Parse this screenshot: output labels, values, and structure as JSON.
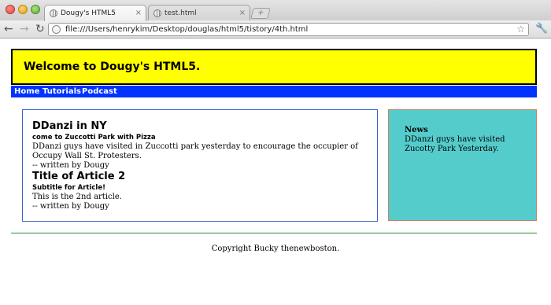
{
  "browser": {
    "tabs": [
      {
        "title": "Dougy's HTML5",
        "active": true
      },
      {
        "title": "test.html",
        "active": false
      }
    ],
    "close_glyph": "×",
    "new_tab_glyph": "+",
    "url": "file:///Users/henrykim/Desktop/douglas/html5/tistory/4th.html",
    "icons": {
      "back": "back-arrow-icon",
      "forward": "forward-arrow-icon",
      "reload": "reload-icon",
      "bookmark": "star-icon",
      "menu": "wrench-icon"
    }
  },
  "page": {
    "header_title": "Welcome to Dougy's HTML5.",
    "nav": [
      "Home",
      "Tutorials",
      "Podcast"
    ],
    "articles": [
      {
        "title": "DDanzi in NY",
        "subtitle": "come to Zuccotti Park with Pizza",
        "body": "DDanzi guys have visited in Zuccotti park yesterday to encourage the occupier of Occupy Wall St. Protesters.",
        "footer": "-- written by Dougy"
      },
      {
        "title": "Title of Article 2",
        "subtitle": "Subtitle for Article!",
        "body": "This is the 2nd article.",
        "footer": "-- written by Dougy"
      }
    ],
    "aside": {
      "title": "News",
      "body": "DDanzi guys have visited Zucotty Park Yesterday."
    },
    "footer": "Copyright Bucky thenewboston."
  },
  "colors": {
    "header_bg": "#ffff00",
    "nav_bg": "#0033ff",
    "aside_bg": "#55cccc",
    "footer_rule": "#2a8a2a"
  }
}
